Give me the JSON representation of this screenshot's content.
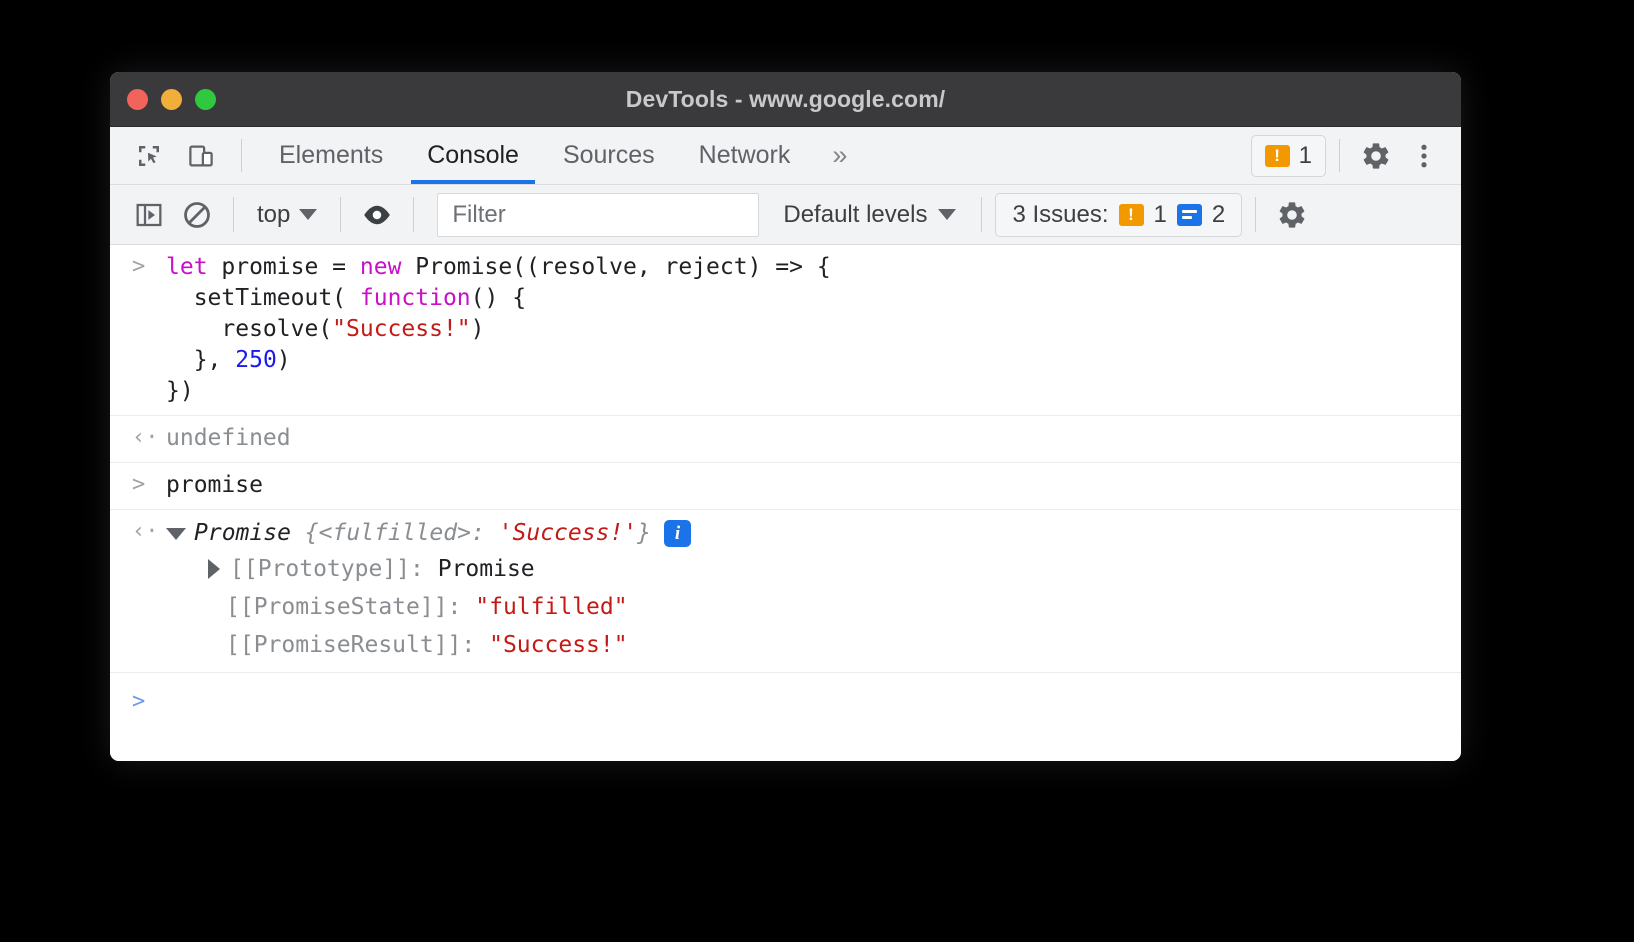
{
  "window": {
    "title": "DevTools - www.google.com/",
    "traffic_lights": [
      "close",
      "minimize",
      "maximize"
    ]
  },
  "tabbar": {
    "inspect_icon": "inspect-element-icon",
    "device_icon": "device-toolbar-icon",
    "tabs": [
      {
        "label": "Elements",
        "active": false
      },
      {
        "label": "Console",
        "active": true
      },
      {
        "label": "Sources",
        "active": false
      },
      {
        "label": "Network",
        "active": false
      }
    ],
    "more_tabs": "»",
    "warning_badge": {
      "icon": "warning-bubble-icon",
      "count": "1"
    },
    "settings_icon": "gear-icon",
    "menu_icon": "kebab-menu-icon"
  },
  "console_toolbar": {
    "sidebar_toggle_icon": "console-sidebar-icon",
    "clear_icon": "clear-console-icon",
    "context": "top",
    "eye_icon": "live-expression-eye-icon",
    "filter_placeholder": "Filter",
    "filter_value": "",
    "levels": "Default levels",
    "issues_label": "3 Issues:",
    "issues_warning_count": "1",
    "issues_info_count": "2",
    "settings_icon": "gear-icon"
  },
  "console": {
    "input_marker": ">",
    "output_marker": "‹·",
    "entry1": {
      "line1_a": "let ",
      "line1_b": "promise = ",
      "line1_c": "new ",
      "line1_d": "Promise((resolve, reject) => {",
      "line2_a": "  setTimeout( ",
      "line2_b": "function",
      "line2_c": "() {",
      "line3_a": "    resolve(",
      "line3_b": "\"Success!\"",
      "line3_c": ")",
      "line4_a": "  }, ",
      "line4_b": "250",
      "line4_c": ")",
      "line5": "})"
    },
    "entry1_result": "undefined",
    "entry2_input": "promise",
    "entry2_result": {
      "name": "Promise",
      "brace_open": " {",
      "state": "<fulfilled>",
      "colon": ": ",
      "value": "'Success!'",
      "brace_close": "}",
      "info_badge": "i"
    },
    "properties": [
      {
        "key": "[[Prototype]]: ",
        "value": "Promise",
        "value_kind": "dark",
        "expandable": true
      },
      {
        "key": "[[PromiseState]]: ",
        "value": "\"fulfilled\"",
        "value_kind": "string",
        "expandable": false
      },
      {
        "key": "[[PromiseResult]]: ",
        "value": "\"Success!\"",
        "value_kind": "string",
        "expandable": false
      }
    ],
    "prompt_marker": ">"
  },
  "colors": {
    "accent_blue": "#1a73e8",
    "warning_orange": "#f29900",
    "string_red": "#c41a16",
    "keyword_magenta": "#c90fc9",
    "number_blue": "#1a1aee",
    "titlebar_bg": "#3a3a3c",
    "toolbar_bg": "#f1f3f4"
  }
}
